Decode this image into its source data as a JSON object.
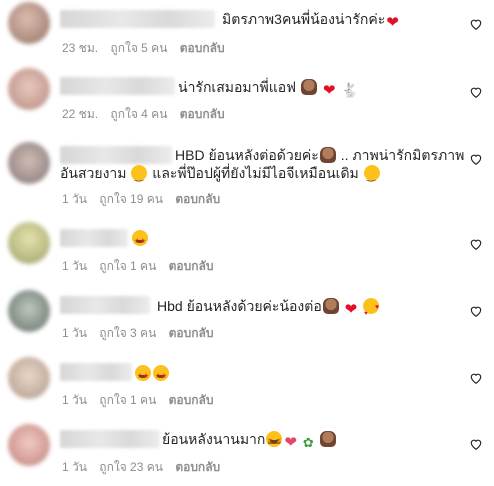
{
  "comments": [
    {
      "text": "มิตรภาพ3คนพี่น้องน่ารักค่ะ",
      "emojis": [
        "heart-emoji"
      ],
      "time": "23 ชม.",
      "likes": "ถูกใจ 5 คน",
      "reply": "ตอบกลับ"
    },
    {
      "text": "น่ารักเสมอมาพี่แอฟ",
      "emojis": [
        "cake-emoji",
        "heart-emoji",
        "rabbit-emoji"
      ],
      "time": "22 ชม.",
      "likes": "ถูกใจ 4 คน",
      "reply": "ตอบกลับ"
    },
    {
      "text_line1": "HBD ย้อนหลังต่อด้วยค่ะ",
      "text_line1b": " .. ภาพน่ารักมิตรภาพ",
      "text_line2": "อันสวยงาม",
      "text_line2b": " และพี่ป๊อปผู้ที่ยังไม่มีไอจีเหมือนเดิม",
      "emojis": [
        "cake-emoji",
        "smile-emoji",
        "smile-emoji"
      ],
      "time": "1 วัน",
      "likes": "ถูกใจ 19 คน",
      "reply": "ตอบกลับ"
    },
    {
      "text": "",
      "emojis": [
        "star-struck-emoji"
      ],
      "time": "1 วัน",
      "likes": "ถูกใจ 1 คน",
      "reply": "ตอบกลับ"
    },
    {
      "text": "Hbd ย้อนหลังด้วยค่ะน้องต่อ",
      "emojis": [
        "cake-emoji",
        "heart-emoji",
        "smiling-hearts-emoji"
      ],
      "time": "1 วัน",
      "likes": "ถูกใจ 3 คน",
      "reply": "ตอบกลับ"
    },
    {
      "text": "",
      "emojis": [
        "star-struck-emoji",
        "star-struck-emoji"
      ],
      "time": "1 วัน",
      "likes": "ถูกใจ 1 คน",
      "reply": "ตอบกลับ"
    },
    {
      "text": "ย้อนหลังนานมาก",
      "emojis": [
        "laughing-emoji",
        "pink-heart-emoji",
        "bouquet-emoji",
        "cake-emoji"
      ],
      "time": "1 วัน",
      "likes": "ถูกใจ 23 คน",
      "reply": "ตอบกลับ"
    }
  ],
  "glyphs": {
    "heart": "❤",
    "rabbit": "🐇",
    "like_icon": "heart-outline-icon"
  },
  "colors": {
    "text": "#262626",
    "meta": "#8e8e8e",
    "heart_red": "#e0102a",
    "background": "#ffffff"
  }
}
